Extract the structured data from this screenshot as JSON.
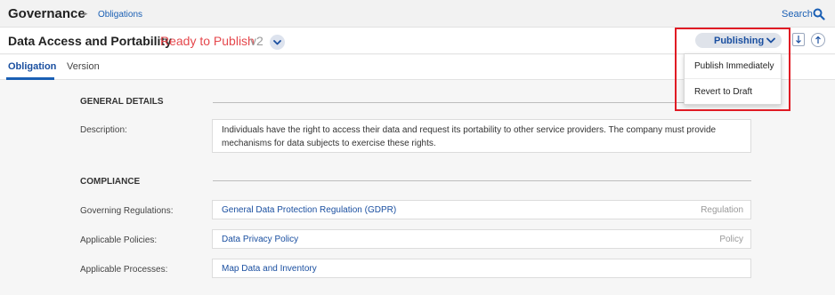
{
  "topbar": {
    "app_title": "Governance",
    "crumb_sep": "▸",
    "breadcrumb": "Obligations",
    "search_label": "Search"
  },
  "obligation": {
    "title": "Data Access and Portability",
    "status": "Ready to Publish",
    "version": "v2"
  },
  "actions": {
    "publishing_label": "Publishing"
  },
  "publish_menu": {
    "items": [
      "Publish Immediately",
      "Revert to Draft"
    ]
  },
  "tabs": [
    "Obligation",
    "Version"
  ],
  "general": {
    "heading": "GENERAL DETAILS",
    "description_label": "Description:",
    "description_lines": [
      "Individuals have the right to access their data and request its portability to other service providers. The company must provide",
      "mechanisms for data subjects to exercise these rights."
    ]
  },
  "compliance": {
    "heading": "COMPLIANCE",
    "rows": [
      {
        "label": "Governing Regulations:",
        "value": "General Data Protection Regulation (GDPR)",
        "type": "Regulation"
      },
      {
        "label": "Applicable Policies:",
        "value": "Data Privacy Policy",
        "type": "Policy"
      },
      {
        "label": "Applicable Processes:",
        "value": "Map Data and Inventory",
        "type": ""
      }
    ]
  },
  "colors": {
    "accent": "#1a4fa0",
    "status": "#e5484d",
    "highlight": "#e01b24"
  },
  "icons": {
    "search": "search-icon",
    "chevron": "chevron-down-icon",
    "download": "download-icon",
    "upload": "upload-icon"
  }
}
